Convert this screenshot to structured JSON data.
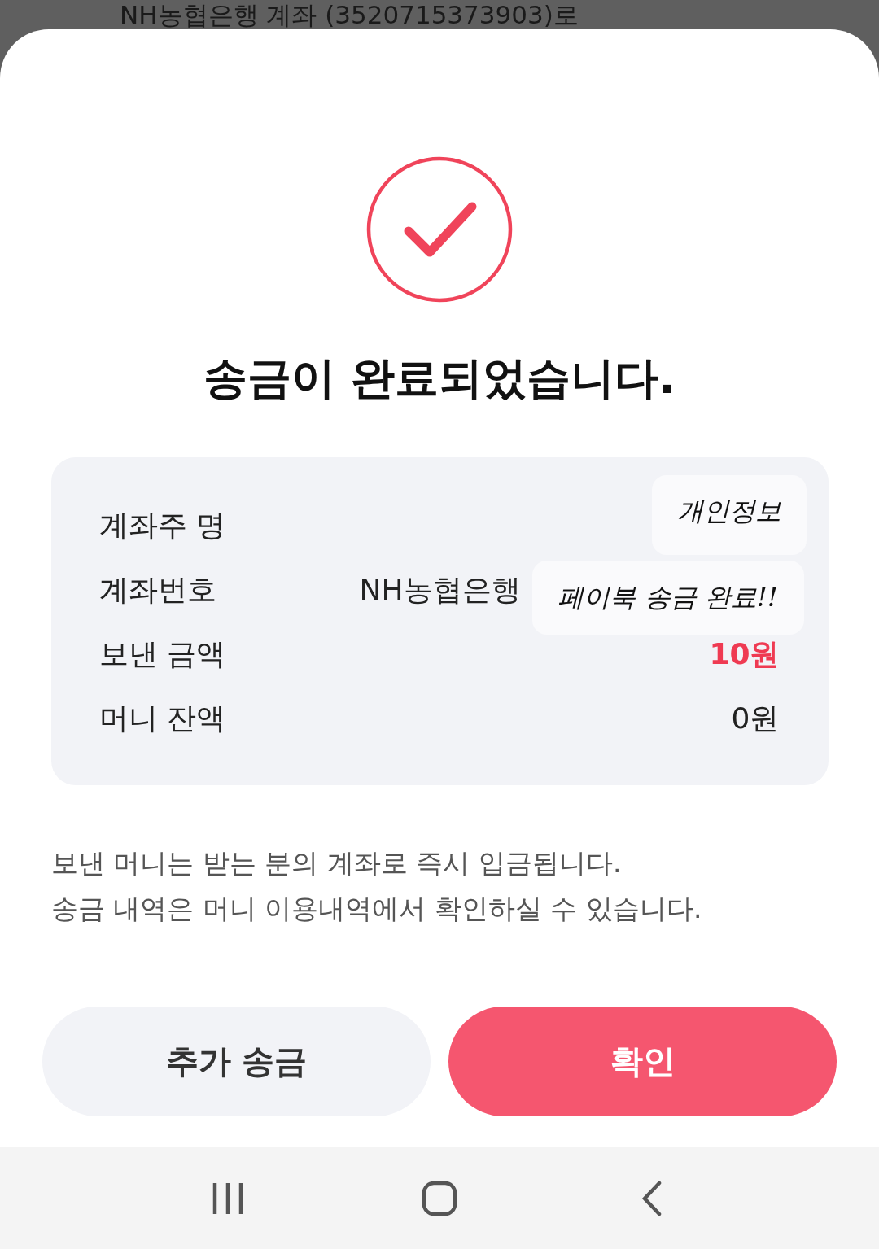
{
  "background_text": "NH농협은행 계좌 (3520715373903)로",
  "title": "송금이 완료되었습니다.",
  "details": [
    {
      "label": "계좌주 명"
    },
    {
      "label": "계좌번호",
      "value": "NH농협은행",
      "highlight": false
    },
    {
      "label": "보낸 금액",
      "value": "10원",
      "highlight": true
    },
    {
      "label": "머니 잔액",
      "value": "0원",
      "highlight": false
    }
  ],
  "stickers": [
    "개인정보",
    "페이북 송금 완료!!"
  ],
  "notes": [
    "보낸 머니는 받는 분의 계좌로 즉시 입금됩니다.",
    "송금 내역은 머니 이용내역에서 확인하실 수 있습니다."
  ],
  "buttons": [
    {
      "label": "추가 송금",
      "kind": "secondary"
    },
    {
      "label": "확인",
      "kind": "primary"
    }
  ]
}
